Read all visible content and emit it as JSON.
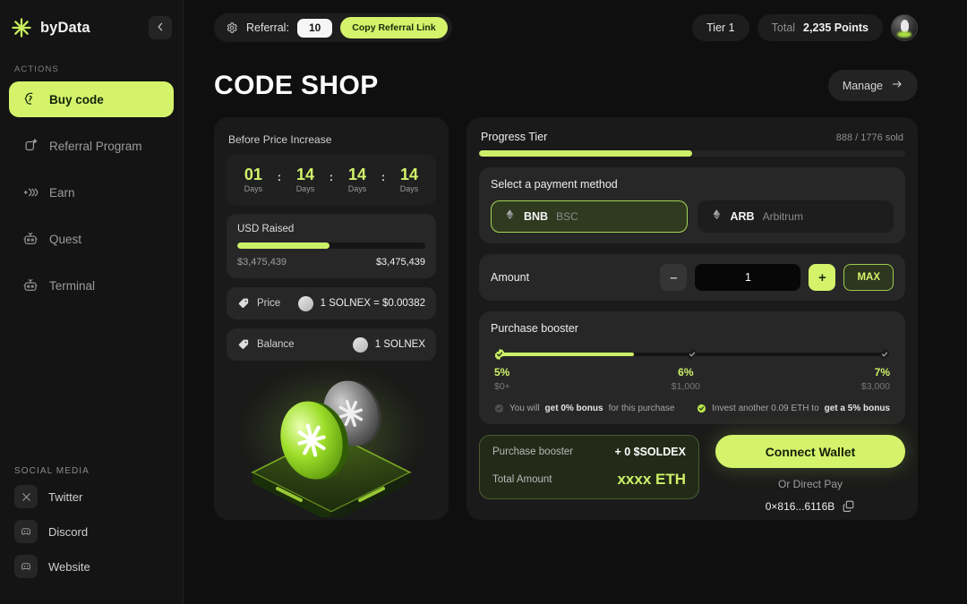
{
  "sidebar": {
    "brand": {
      "name": "byData",
      "logo_icon": "sparkle-logo-icon"
    },
    "collapse_icon": "chevron-left-icon",
    "actions_label": "ACTIONS",
    "items": [
      {
        "label": "Buy code",
        "icon": "brain-icon",
        "active": true
      },
      {
        "label": "Referral Program",
        "icon": "referral-sparkle-icon",
        "active": false
      },
      {
        "label": "Earn",
        "icon": "earn-waves-icon",
        "active": false
      },
      {
        "label": "Quest",
        "icon": "quest-robot-icon",
        "active": false
      },
      {
        "label": "Terminal",
        "icon": "terminal-robot-icon",
        "active": false
      }
    ],
    "social_label": "SOCIAL MEDIA",
    "social": [
      {
        "label": "Twitter",
        "icon": "twitter-x-icon"
      },
      {
        "label": "Discord",
        "icon": "discord-icon"
      },
      {
        "label": "Website",
        "icon": "website-icon"
      }
    ]
  },
  "topbar": {
    "referral_label": "Referral:",
    "referral_value": "10",
    "copy_referral_label": "Copy Referral Link",
    "gear_icon": "gear-icon",
    "tier": "Tier 1",
    "total_label": "Total",
    "points_value": "2,235 Points",
    "avatar_icon": "avatar"
  },
  "page": {
    "title": "CODE SHOP",
    "manage_label": "Manage",
    "manage_arrow_icon": "arrow-right-icon"
  },
  "left_card": {
    "title": "Before Price Increase",
    "timer": [
      {
        "value": "01",
        "label": "Days"
      },
      {
        "value": "14",
        "label": "Days"
      },
      {
        "value": "14",
        "label": "Days"
      },
      {
        "value": "14",
        "label": "Days"
      }
    ],
    "separator": ":",
    "raised": {
      "title": "USD Raised",
      "progress_pct": 49,
      "current": "$3,475,439",
      "goal": "$3,475,439"
    },
    "price_row": {
      "label": "Price",
      "value": "1 SOLNEX = $0.00382",
      "icon": "price-tag-icon"
    },
    "balance_row": {
      "label": "Balance",
      "value": "1 SOLNEX",
      "icon": "price-tag-icon"
    }
  },
  "right_card": {
    "progress": {
      "title": "Progress Tier",
      "sold_text": "888 / 1776 sold",
      "progress_pct": 50
    },
    "payment": {
      "title": "Select a payment method",
      "methods": [
        {
          "symbol": "BNB",
          "network": "BSC",
          "selected": true,
          "icon": "eth-diamond-icon"
        },
        {
          "symbol": "ARB",
          "network": "Arbitrum",
          "selected": false,
          "icon": "eth-diamond-icon"
        }
      ]
    },
    "amount": {
      "label": "Amount",
      "value": "1",
      "placeholder": "0",
      "minus_label": "–",
      "plus_label": "+",
      "max_label": "MAX"
    },
    "booster": {
      "title": "Purchase booster",
      "fill_pct": 34,
      "tiers": [
        {
          "pct": "5%",
          "amount": "$0+",
          "reached": true
        },
        {
          "pct": "6%",
          "amount": "$1,000",
          "reached": false
        },
        {
          "pct": "7%",
          "amount": "$3,000",
          "reached": false
        }
      ],
      "note_left_pre": "You will ",
      "note_left_bold": "get 0% bonus",
      "note_left_post": " for this purchase",
      "note_right_pre": "Invest another 0.09 ETH to ",
      "note_right_bold": "get a 5% bonus"
    },
    "summary": {
      "booster_label": "Purchase booster",
      "booster_value": "+ 0 $SOLDEX",
      "total_label": "Total Amount",
      "total_value": "xxxx ETH"
    },
    "wallet": {
      "connect_label": "Connect Wallet",
      "direct_pay_label": "Or Direct Pay",
      "address": "0×816...6116B",
      "copy_icon": "copy-icon"
    }
  },
  "colors": {
    "accent": "#d4f36b",
    "accent_bright": "#cdf069",
    "bg": "#0f0f0f",
    "card": "#1a1a1a",
    "panel": "#272727"
  }
}
